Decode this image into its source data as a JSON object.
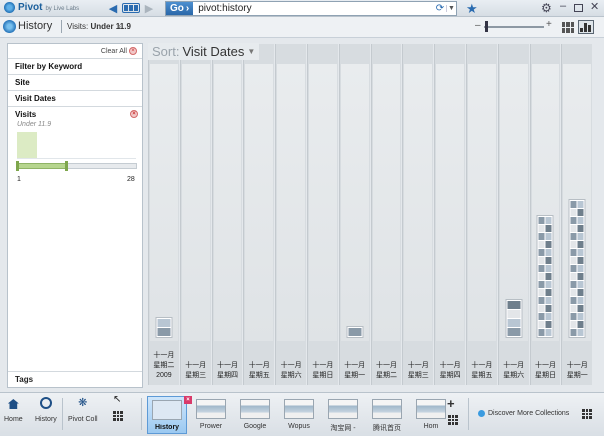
{
  "app": {
    "name": "Pivot",
    "sub": "by Live Labs"
  },
  "address": {
    "go_label": "Go",
    "value": "pivot:history"
  },
  "breadcrumb": {
    "title": "History",
    "filter_label": "Visits:",
    "filter_value": "Under 11.9"
  },
  "filter_panel": {
    "clear_all": "Clear All",
    "keyword": "Filter by Keyword",
    "site": "Site",
    "visit_dates": "Visit Dates",
    "visits": "Visits",
    "visits_sub": "Under 11.9",
    "range_min": "1",
    "range_max": "28",
    "selected_fraction": 0.41,
    "tags": "Tags"
  },
  "sort": {
    "label": "Sort:",
    "value": "Visit Dates"
  },
  "columns": [
    {
      "l1": "十一月",
      "l2": "星期二",
      "l3": "2009",
      "items": 2
    },
    {
      "l1": "十一月",
      "l2": "星期三",
      "l3": "",
      "items": 0
    },
    {
      "l1": "十一月",
      "l2": "星期四",
      "l3": "",
      "items": 0
    },
    {
      "l1": "十一月",
      "l2": "星期五",
      "l3": "",
      "items": 0
    },
    {
      "l1": "十一月",
      "l2": "星期六",
      "l3": "",
      "items": 0
    },
    {
      "l1": "十一月",
      "l2": "星期日",
      "l3": "",
      "items": 0
    },
    {
      "l1": "十一月",
      "l2": "星期一",
      "l3": "",
      "items": 1
    },
    {
      "l1": "十一月",
      "l2": "星期二",
      "l3": "",
      "items": 0
    },
    {
      "l1": "十一月",
      "l2": "星期三",
      "l3": "",
      "items": 0
    },
    {
      "l1": "十一月",
      "l2": "星期四",
      "l3": "",
      "items": 0
    },
    {
      "l1": "十一月",
      "l2": "星期五",
      "l3": "",
      "items": 0
    },
    {
      "l1": "十一月",
      "l2": "星期六",
      "l3": "",
      "items": 4
    },
    {
      "l1": "十一月",
      "l2": "星期日",
      "l3": "",
      "items": 30
    },
    {
      "l1": "十一月",
      "l2": "星期一",
      "l3": "",
      "items": 34
    }
  ],
  "taskbar": {
    "home": "Home",
    "history": "History",
    "pivot_collections": "Pivot Coll",
    "tabs": [
      "History",
      "Prower",
      "Google",
      "Wopus",
      "淘宝网 -",
      "腾讯首页",
      "Hom"
    ],
    "discover": "Discover More Collections"
  },
  "colors": {
    "accent": "#2a6bb0",
    "range_fill": "#b6d58e",
    "active_tab": "#9bc9f1"
  }
}
